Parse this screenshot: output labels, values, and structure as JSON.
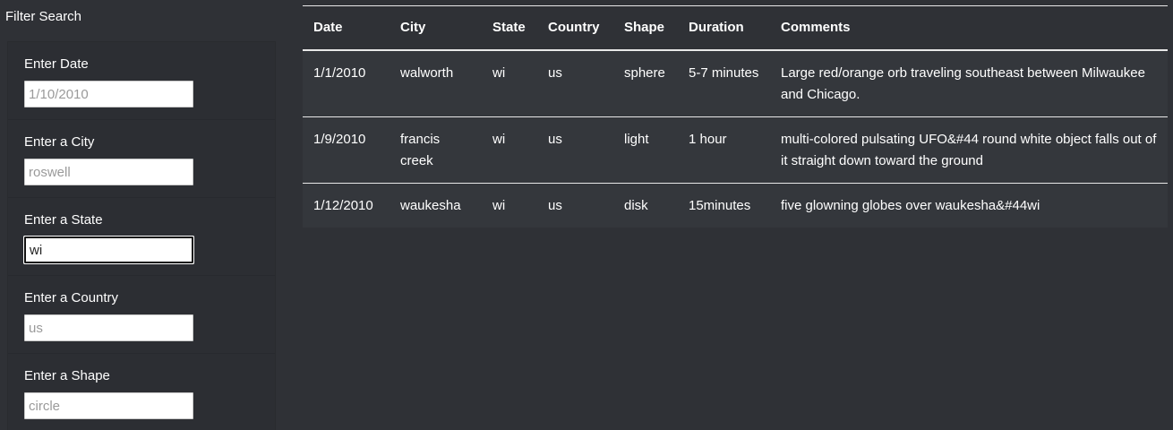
{
  "sidebar": {
    "title": "Filter Search",
    "filters": [
      {
        "label": "Enter Date",
        "value": "",
        "placeholder": "1/10/2010"
      },
      {
        "label": "Enter a City",
        "value": "",
        "placeholder": "roswell"
      },
      {
        "label": "Enter a State",
        "value": "wi",
        "placeholder": ""
      },
      {
        "label": "Enter a Country",
        "value": "",
        "placeholder": "us"
      },
      {
        "label": "Enter a Shape",
        "value": "",
        "placeholder": "circle"
      }
    ]
  },
  "table": {
    "headers": [
      "Date",
      "City",
      "State",
      "Country",
      "Shape",
      "Duration",
      "Comments"
    ],
    "rows": [
      [
        "1/1/2010",
        "walworth",
        "wi",
        "us",
        "sphere",
        "5-7 minutes",
        "Large red/orange orb traveling southeast between Milwaukee and Chicago."
      ],
      [
        "1/9/2010",
        "francis creek",
        "wi",
        "us",
        "light",
        "1 hour",
        "multi-colored pulsating UFO&#44 round white object falls out of it straight down toward the ground"
      ],
      [
        "1/12/2010",
        "waukesha",
        "wi",
        "us",
        "disk",
        "15minutes",
        "five glowning globes over waukesha&#44wi"
      ]
    ]
  }
}
